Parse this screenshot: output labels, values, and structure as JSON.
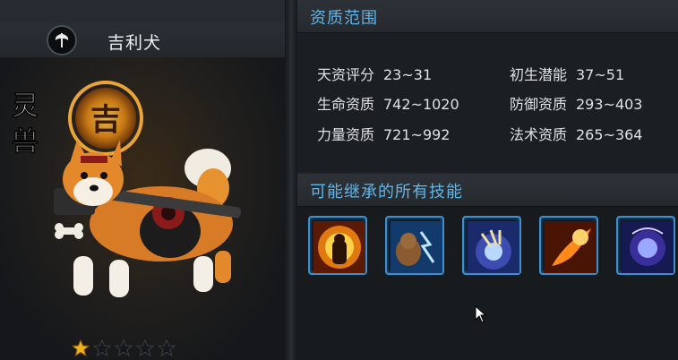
{
  "pet": {
    "name": "吉利犬",
    "rank_badge": "灵兽",
    "halo_glyph": "吉",
    "class_icon": "axe-icon",
    "stars_filled": 1,
    "stars_total": 5
  },
  "aptitude": {
    "title": "资质范围",
    "stats": [
      {
        "label": "天资评分",
        "value": "23~31"
      },
      {
        "label": "初生潜能",
        "value": "37~51"
      },
      {
        "label": "生命资质",
        "value": "742~1020"
      },
      {
        "label": "防御资质",
        "value": "293~403"
      },
      {
        "label": "力量资质",
        "value": "721~992"
      },
      {
        "label": "法术资质",
        "value": "265~364"
      }
    ]
  },
  "skills": {
    "title": "可能继承的所有技能",
    "items": [
      {
        "icon": "demon-fire-skill-icon"
      },
      {
        "icon": "beast-lightning-skill-icon"
      },
      {
        "icon": "claw-burst-skill-icon"
      },
      {
        "icon": "flame-fist-skill-icon"
      },
      {
        "icon": "arcane-orb-skill-icon"
      }
    ]
  },
  "colors": {
    "accent": "#62b6e8",
    "skill_border": "#3d8fd0",
    "star_gold": "#f0b020"
  }
}
